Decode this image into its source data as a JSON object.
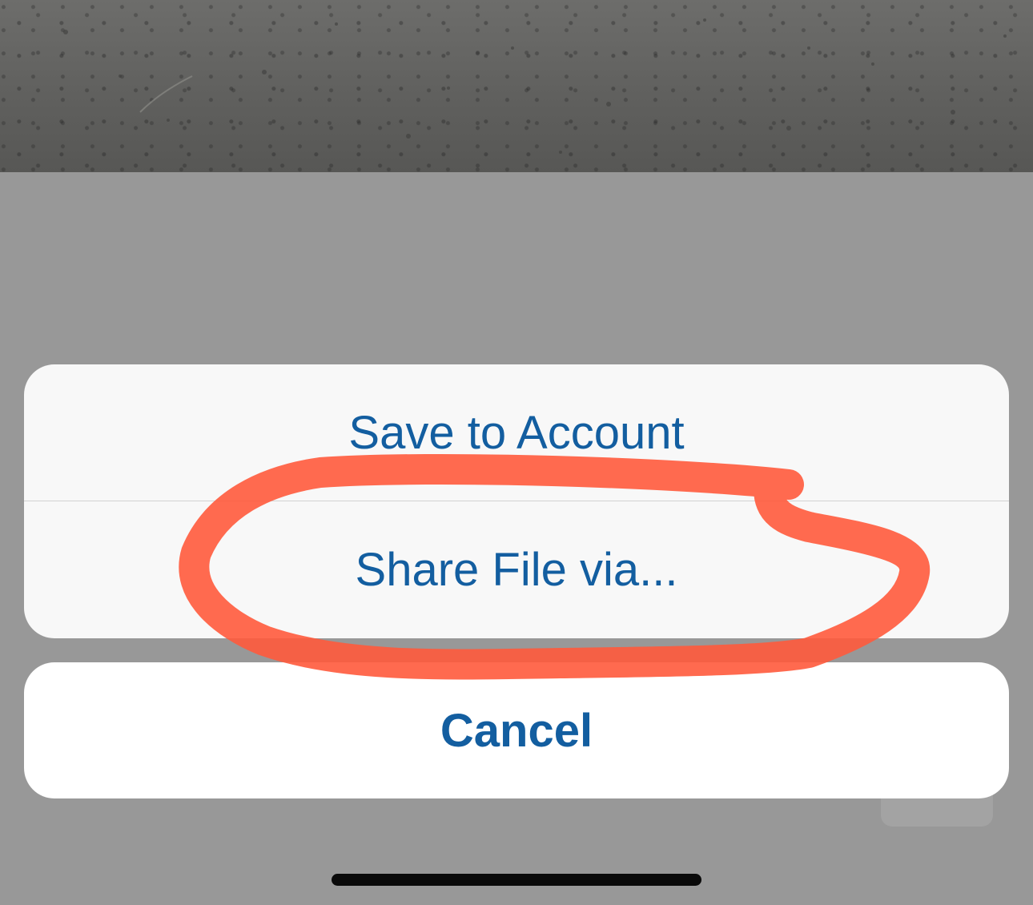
{
  "action_sheet": {
    "items": [
      {
        "label": "Save to Account"
      },
      {
        "label": "Share File via..."
      }
    ],
    "cancel_label": "Cancel"
  },
  "colors": {
    "action_text": "#135ea0",
    "annotation": "#ff5a3c",
    "sheet_background": "#f8f8f8",
    "dim_overlay": "#989898"
  },
  "annotation": {
    "type": "hand-drawn-circle",
    "highlights": "Share File via..."
  }
}
